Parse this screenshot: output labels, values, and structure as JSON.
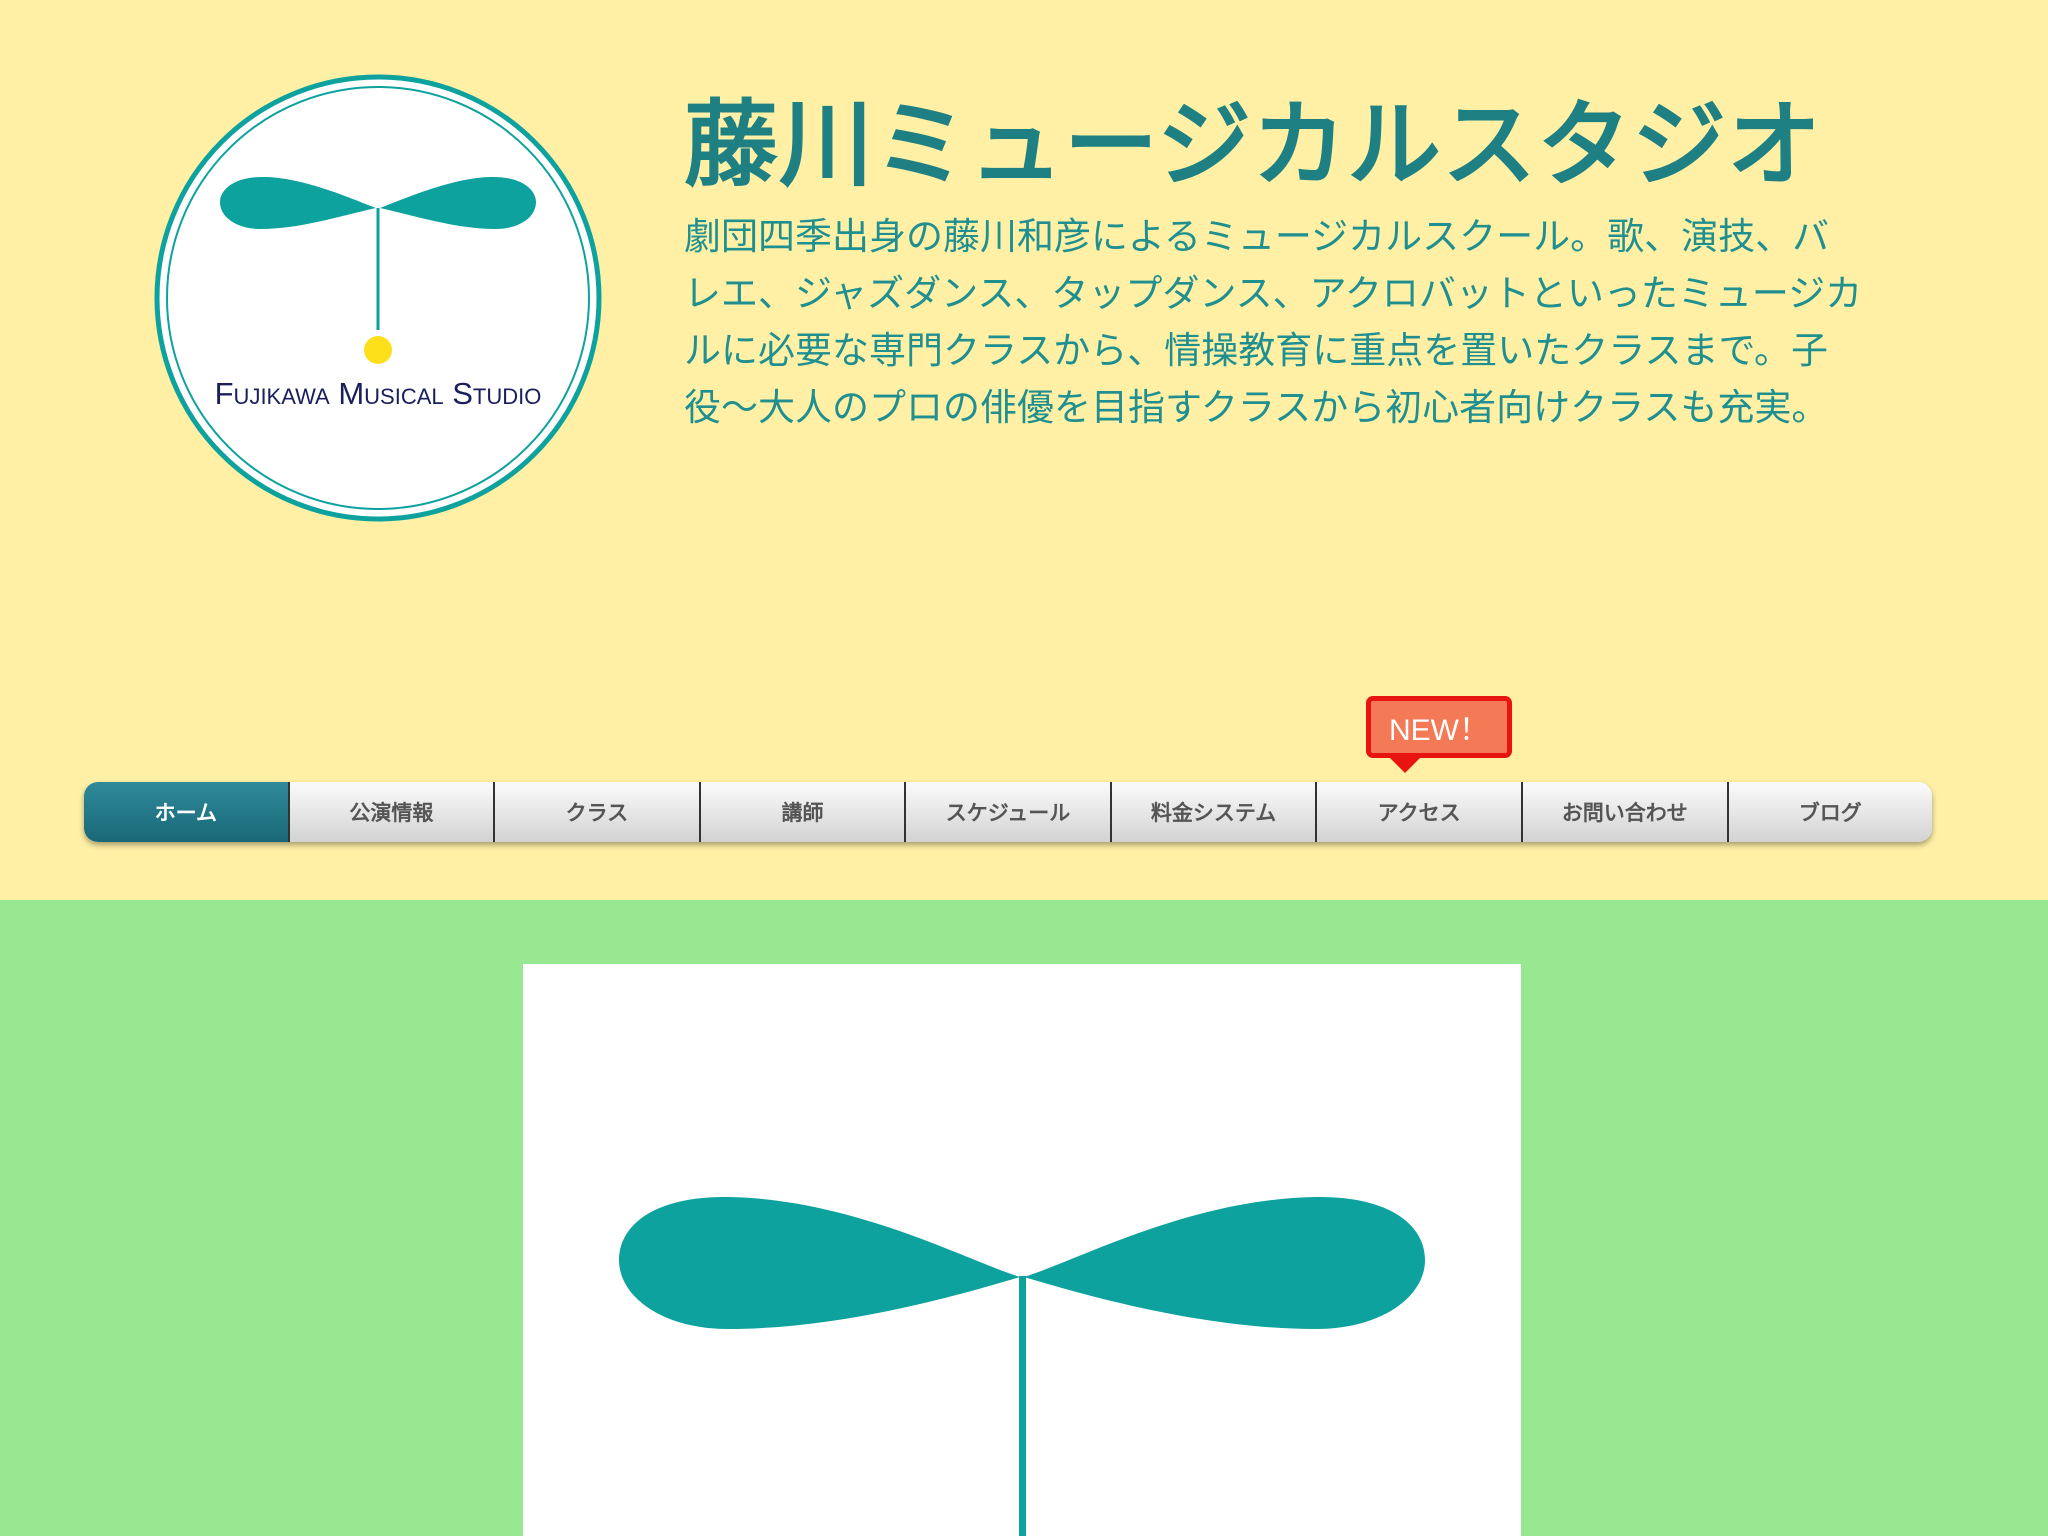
{
  "site": {
    "title": "藤川ミュージカルスタジオ",
    "description": "劇団四季出身の藤川和彦によるミュージカルスクール。歌、演技、バレエ、ジャズダンス、タップダンス、アクロバットといったミュージカルに必要な専門クラスから、情操教育に重点を置いたクラスまで。子役〜大人のプロの俳優を目指すクラスから初心者向けクラスも充実。",
    "logo_text": "Fujikawa Musical Studio"
  },
  "nav": {
    "items": [
      {
        "label": "ホーム"
      },
      {
        "label": "公演情報"
      },
      {
        "label": "クラス"
      },
      {
        "label": "講師"
      },
      {
        "label": "スケジュール"
      },
      {
        "label": "料金システム"
      },
      {
        "label": "アクセス"
      },
      {
        "label": "お問い合わせ"
      },
      {
        "label": "ブログ"
      }
    ],
    "active_index": 0,
    "new_badge": "NEW！"
  },
  "colors": {
    "header_bg": "#fff0a6",
    "body_bg": "#97e891",
    "brand_teal": "#0da29e",
    "title_teal": "#1e8082",
    "seed_yellow": "#fde01a",
    "logo_text_navy": "#1a1f5c",
    "badge_red": "#e8140f"
  }
}
